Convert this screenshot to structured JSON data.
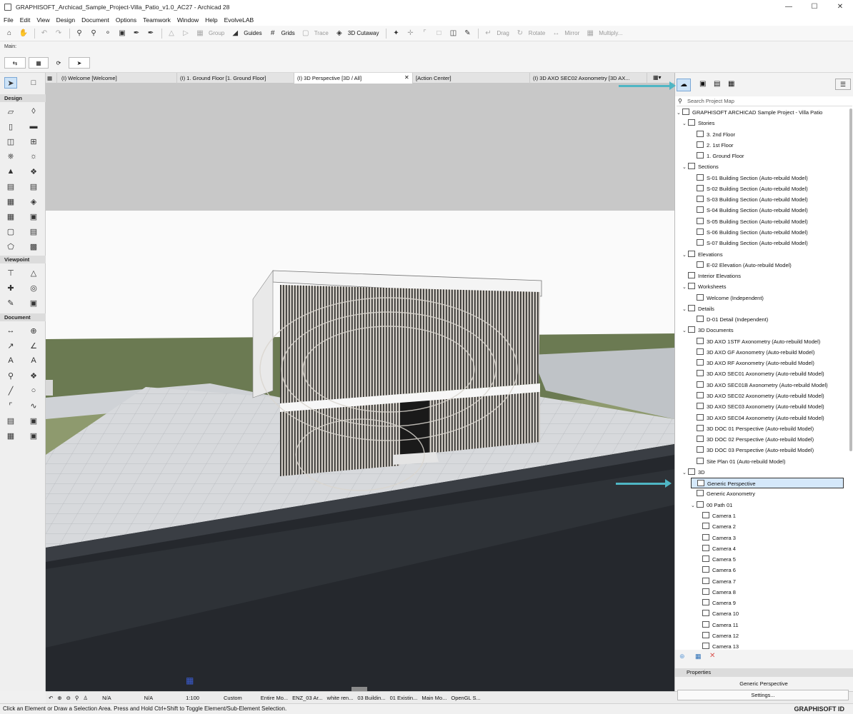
{
  "window": {
    "title": "GRAPHISOFT_Archicad_Sample_Project-Villa_Patio_v1.0_AC27 - Archicad 28"
  },
  "menu": [
    "File",
    "Edit",
    "View",
    "Design",
    "Document",
    "Options",
    "Teamwork",
    "Window",
    "Help",
    "EvolveLAB"
  ],
  "toolbar": {
    "group": "Group",
    "guides": "Guides",
    "grids": "Grids",
    "trace": "Trace",
    "cutaway": "3D Cutaway",
    "drag": "Drag",
    "rotate": "Rotate",
    "mirror": "Mirror",
    "multiply": "Multiply..."
  },
  "infobox": {
    "label": "Main:"
  },
  "toolbox": {
    "design": "Design",
    "viewpoint": "Viewpoint",
    "document": "Document"
  },
  "tabs": [
    "(I) Welcome [Welcome]",
    "(I) 1. Ground Floor [1. Ground Floor]",
    "(I) 3D Perspective [3D / All]",
    "[Action Center]",
    "(I) 3D AXO SEC02 Axonometry [3D AX..."
  ],
  "navigator": {
    "search_placeholder": "Search Project Map",
    "tree": [
      {
        "label": "GRAPHISOFT ARCHICAD Sample Project - Villa Patio",
        "level": 0,
        "tw": "v"
      },
      {
        "label": "Stories",
        "level": 1,
        "tw": "v"
      },
      {
        "label": "3. 2nd Floor",
        "level": 2
      },
      {
        "label": "2. 1st Floor",
        "level": 2
      },
      {
        "label": "1. Ground Floor",
        "level": 2
      },
      {
        "label": "Sections",
        "level": 1,
        "tw": "v"
      },
      {
        "label": "S-01 Building Section (Auto-rebuild Model)",
        "level": 2
      },
      {
        "label": "S-02 Building Section (Auto-rebuild Model)",
        "level": 2
      },
      {
        "label": "S-03 Building Section (Auto-rebuild Model)",
        "level": 2
      },
      {
        "label": "S-04 Building Section (Auto-rebuild Model)",
        "level": 2
      },
      {
        "label": "S-05 Building Section (Auto-rebuild Model)",
        "level": 2
      },
      {
        "label": "S-06 Building Section (Auto-rebuild Model)",
        "level": 2
      },
      {
        "label": "S-07 Building Section (Auto-rebuild Model)",
        "level": 2
      },
      {
        "label": "Elevations",
        "level": 1,
        "tw": "v"
      },
      {
        "label": "E-02 Elevation (Auto-rebuild Model)",
        "level": 2
      },
      {
        "label": "Interior Elevations",
        "level": 1
      },
      {
        "label": "Worksheets",
        "level": 1,
        "tw": "v"
      },
      {
        "label": "Welcome (Independent)",
        "level": 2
      },
      {
        "label": "Details",
        "level": 1,
        "tw": "v"
      },
      {
        "label": "D-01 Detail (Independent)",
        "level": 2
      },
      {
        "label": "3D Documents",
        "level": 1,
        "tw": "v"
      },
      {
        "label": "3D AXO 1STF Axonometry (Auto-rebuild Model)",
        "level": 2
      },
      {
        "label": "3D AXO GF Axonometry (Auto-rebuild Model)",
        "level": 2
      },
      {
        "label": "3D AXO RF Axonometry (Auto-rebuild Model)",
        "level": 2
      },
      {
        "label": "3D AXO SEC01 Axonometry (Auto-rebuild Model)",
        "level": 2
      },
      {
        "label": "3D AXO SEC01B Axonometry (Auto-rebuild Model)",
        "level": 2
      },
      {
        "label": "3D AXO SEC02 Axonometry (Auto-rebuild Model)",
        "level": 2
      },
      {
        "label": "3D AXO SEC03 Axonometry (Auto-rebuild Model)",
        "level": 2
      },
      {
        "label": "3D AXO SEC04 Axonometry (Auto-rebuild Model)",
        "level": 2
      },
      {
        "label": "3D DOC 01 Perspective (Auto-rebuild Model)",
        "level": 2
      },
      {
        "label": "3D DOC 02 Perspective (Auto-rebuild Model)",
        "level": 2
      },
      {
        "label": "3D DOC 03 Perspective (Auto-rebuild Model)",
        "level": 2
      },
      {
        "label": "Site Plan 01 (Auto-rebuild Model)",
        "level": 2
      },
      {
        "label": "3D",
        "level": 1,
        "tw": "v"
      },
      {
        "label": "Generic Perspective",
        "level": 2,
        "selected": true
      },
      {
        "label": "Generic Axonometry",
        "level": 2
      },
      {
        "label": "00 Path 01",
        "level": 2,
        "tw": "v"
      },
      {
        "label": "Camera 1",
        "level": 3
      },
      {
        "label": "Camera 2",
        "level": 3
      },
      {
        "label": "Camera 3",
        "level": 3
      },
      {
        "label": "Camera 4",
        "level": 3
      },
      {
        "label": "Camera 5",
        "level": 3
      },
      {
        "label": "Camera 6",
        "level": 3
      },
      {
        "label": "Camera 7",
        "level": 3
      },
      {
        "label": "Camera 8",
        "level": 3
      },
      {
        "label": "Camera 9",
        "level": 3
      },
      {
        "label": "Camera 10",
        "level": 3
      },
      {
        "label": "Camera 11",
        "level": 3
      },
      {
        "label": "Camera 12",
        "level": 3
      },
      {
        "label": "Camera 13",
        "level": 3
      }
    ],
    "properties_label": "Properties",
    "properties_value": "Generic Perspective",
    "settings_label": "Settings..."
  },
  "statusbar": {
    "na1": "N/A",
    "na2": "N/A",
    "scale": "1:100",
    "custom": "Custom",
    "entire": "Entire Mo...",
    "enz": "ENZ_03 Ar...",
    "white": "white ren...",
    "building": "03 Buildin...",
    "existing": "01 Existin...",
    "mainmo": "Main Mo...",
    "opengl": "OpenGL S..."
  },
  "hint": "Click an Element or Draw a Selection Area. Press and Hold Ctrl+Shift to Toggle Element/Sub-Element Selection.",
  "brand": "GRAPHISOFT ID",
  "colors": {
    "accent_arrow": "#4fb6c4",
    "selection": "#d5e8fa"
  }
}
